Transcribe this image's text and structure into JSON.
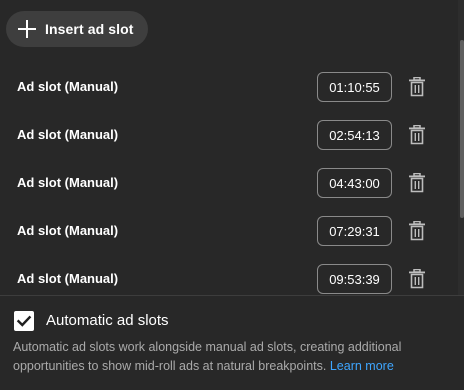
{
  "insert_button": {
    "icon": "plus-icon",
    "label": "Insert ad slot"
  },
  "ad_slots": [
    {
      "label": "Ad slot (Manual)",
      "time": "01:10:55",
      "delete_icon": "trash-icon"
    },
    {
      "label": "Ad slot (Manual)",
      "time": "02:54:13",
      "delete_icon": "trash-icon"
    },
    {
      "label": "Ad slot (Manual)",
      "time": "04:43:00",
      "delete_icon": "trash-icon"
    },
    {
      "label": "Ad slot (Manual)",
      "time": "07:29:31",
      "delete_icon": "trash-icon"
    },
    {
      "label": "Ad slot (Manual)",
      "time": "09:53:39",
      "delete_icon": "trash-icon"
    }
  ],
  "automatic": {
    "checked": true,
    "label": "Automatic ad slots",
    "description": "Automatic ad slots work alongside manual ad slots, creating additional opportunities to show mid-roll ads at natural breakpoints.",
    "link": "Learn more"
  },
  "colors": {
    "background": "#282828",
    "button_bg": "#3e3e3e",
    "link": "#3ea6ff",
    "muted_text": "#aaaaaa"
  }
}
